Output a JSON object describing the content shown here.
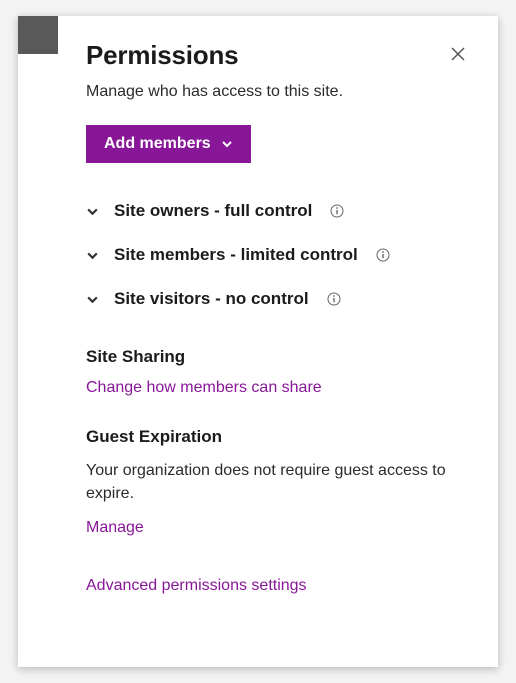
{
  "colors": {
    "accent": "#881798"
  },
  "header": {
    "title": "Permissions",
    "subtitle": "Manage who has access to this site."
  },
  "addMembers": {
    "label": "Add members"
  },
  "groups": [
    {
      "label": "Site owners - full control"
    },
    {
      "label": "Site members - limited control"
    },
    {
      "label": "Site visitors - no control"
    }
  ],
  "siteSharing": {
    "heading": "Site Sharing",
    "link": "Change how members can share"
  },
  "guestExpiration": {
    "heading": "Guest Expiration",
    "body": "Your organization does not require guest access to expire.",
    "manageLink": "Manage"
  },
  "advancedLink": "Advanced permissions settings"
}
